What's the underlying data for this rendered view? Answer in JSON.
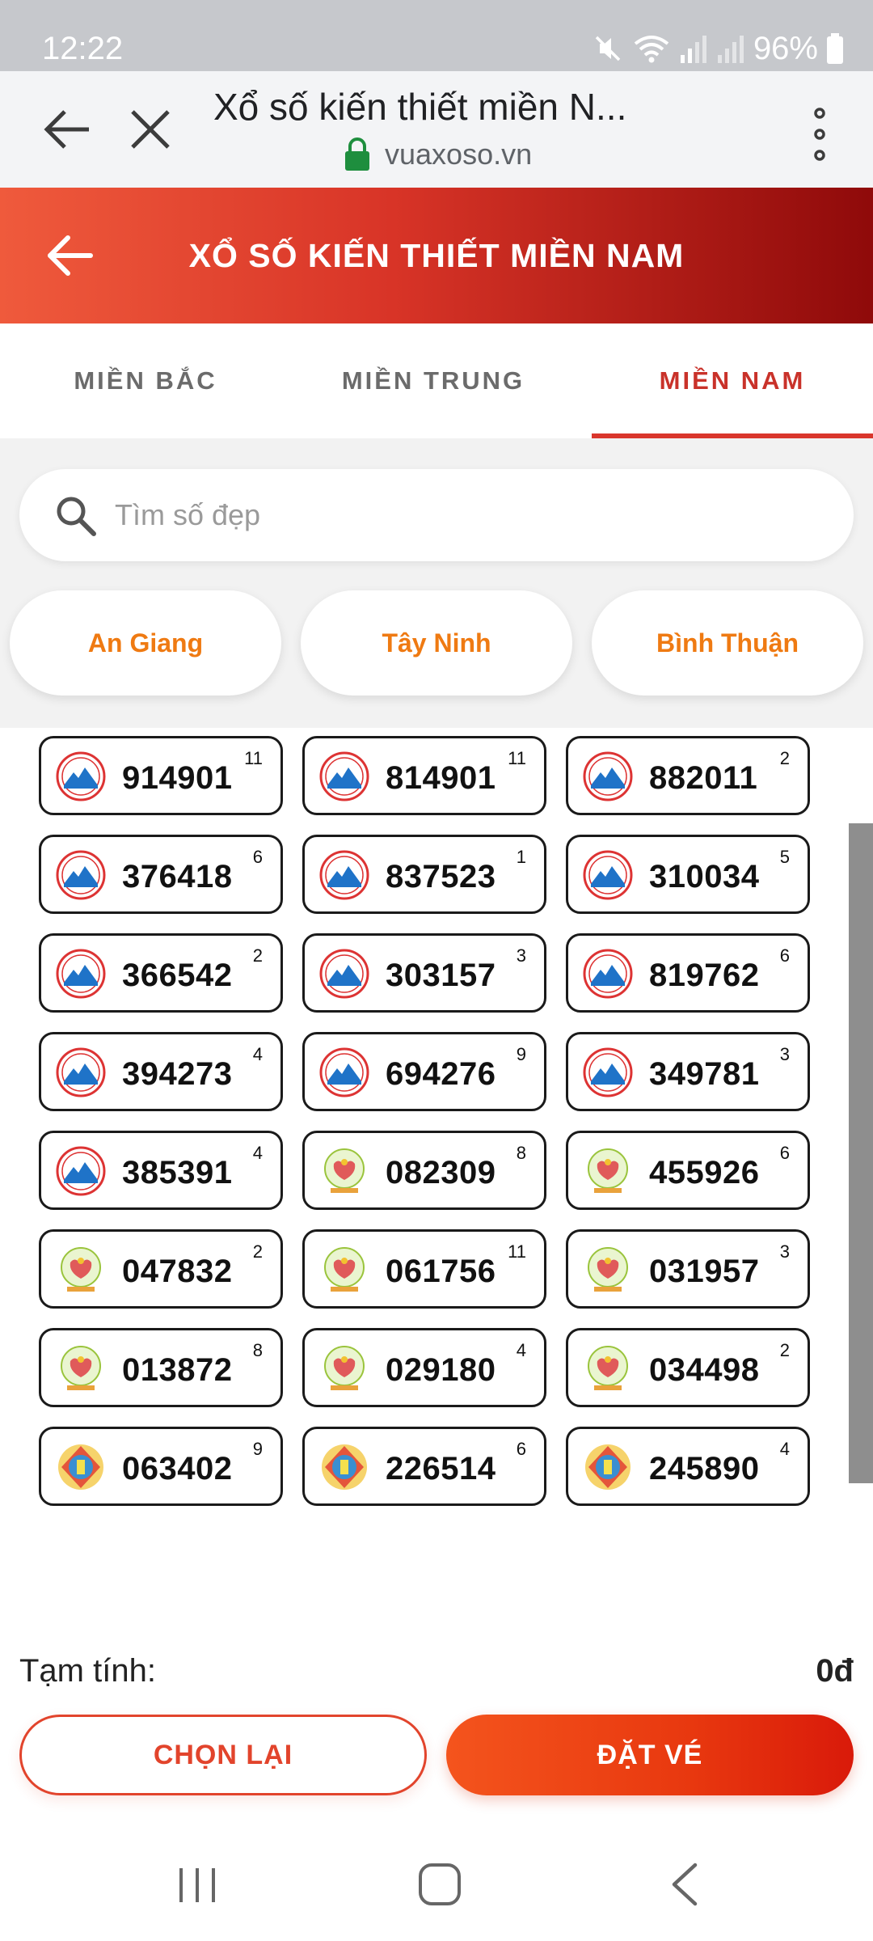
{
  "status_bar": {
    "time": "12:22",
    "battery": "96%"
  },
  "browser": {
    "title": "Xổ số kiến thiết miền N...",
    "url": "vuaxoso.vn"
  },
  "header": {
    "title": "XỔ SỐ KIẾN THIẾT MIỀN NAM"
  },
  "tabs": [
    {
      "label": "MIỀN BẮC"
    },
    {
      "label": "MIỀN TRUNG"
    },
    {
      "label": "MIỀN NAM"
    }
  ],
  "active_tab": "MIỀN NAM",
  "search": {
    "placeholder": "Tìm số đẹp"
  },
  "provinces": [
    {
      "label": "An Giang"
    },
    {
      "label": "Tây Ninh"
    },
    {
      "label": "Bình Thuận"
    }
  ],
  "tickets": [
    {
      "number": "914901",
      "qty": "11",
      "logo": "tay-ninh-logo"
    },
    {
      "number": "814901",
      "qty": "11",
      "logo": "tay-ninh-logo"
    },
    {
      "number": "882011",
      "qty": "2",
      "logo": "tay-ninh-logo"
    },
    {
      "number": "376418",
      "qty": "6",
      "logo": "tay-ninh-logo"
    },
    {
      "number": "837523",
      "qty": "1",
      "logo": "tay-ninh-logo"
    },
    {
      "number": "310034",
      "qty": "5",
      "logo": "tay-ninh-logo"
    },
    {
      "number": "366542",
      "qty": "2",
      "logo": "tay-ninh-logo"
    },
    {
      "number": "303157",
      "qty": "3",
      "logo": "tay-ninh-logo"
    },
    {
      "number": "819762",
      "qty": "6",
      "logo": "tay-ninh-logo"
    },
    {
      "number": "394273",
      "qty": "4",
      "logo": "tay-ninh-logo"
    },
    {
      "number": "694276",
      "qty": "9",
      "logo": "tay-ninh-logo"
    },
    {
      "number": "349781",
      "qty": "3",
      "logo": "tay-ninh-logo"
    },
    {
      "number": "385391",
      "qty": "4",
      "logo": "tay-ninh-logo"
    },
    {
      "number": "082309",
      "qty": "8",
      "logo": "an-giang-logo"
    },
    {
      "number": "455926",
      "qty": "6",
      "logo": "an-giang-logo"
    },
    {
      "number": "047832",
      "qty": "2",
      "logo": "an-giang-logo"
    },
    {
      "number": "061756",
      "qty": "11",
      "logo": "an-giang-logo"
    },
    {
      "number": "031957",
      "qty": "3",
      "logo": "an-giang-logo"
    },
    {
      "number": "013872",
      "qty": "8",
      "logo": "an-giang-logo"
    },
    {
      "number": "029180",
      "qty": "4",
      "logo": "an-giang-logo"
    },
    {
      "number": "034498",
      "qty": "2",
      "logo": "an-giang-logo"
    },
    {
      "number": "063402",
      "qty": "9",
      "logo": "binh-thuan-logo"
    },
    {
      "number": "226514",
      "qty": "6",
      "logo": "binh-thuan-logo"
    },
    {
      "number": "245890",
      "qty": "4",
      "logo": "binh-thuan-logo"
    }
  ],
  "summary": {
    "subtotal_label": "Tạm tính:",
    "subtotal_value": "0đ"
  },
  "actions": {
    "reset_label": "CHỌN LẠI",
    "order_label": "ĐẶT VÉ"
  },
  "colors": {
    "accent": "#d9362c",
    "province_text": "#ef7a12",
    "order_button": "#e8380f"
  }
}
